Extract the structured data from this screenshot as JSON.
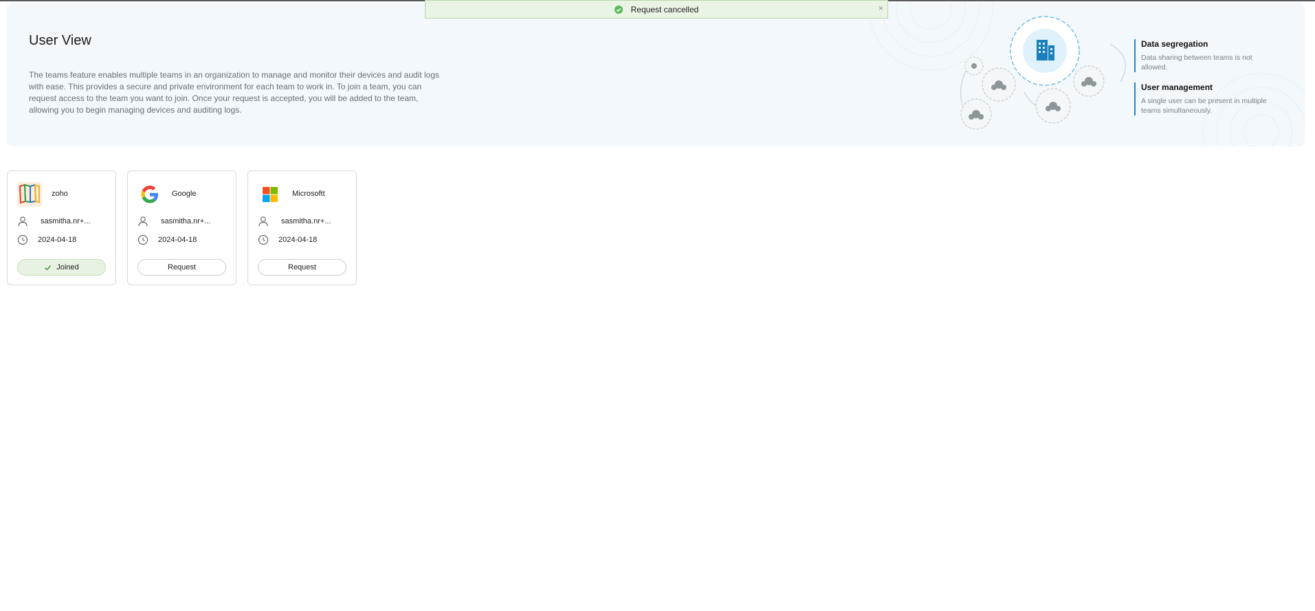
{
  "toast": {
    "message": "Request cancelled",
    "close": "×",
    "status_color": "#5cb85c"
  },
  "banner": {
    "title": "User View",
    "description": "The teams feature enables multiple teams in an organization to manage and monitor their devices and audit logs with ease. This provides a secure and private environment for each team to work in. To join a team, you can request access to the team you want to join. Once your request is accepted, you will be added to the team, allowing you to begin managing devices and auditing logs.",
    "features": [
      {
        "title": "Data segregation",
        "description": "Data sharing between teams is not allowed."
      },
      {
        "title": "User management",
        "description": "A single user can be present in multiple teams simultaneously."
      }
    ],
    "accent_color": "#1c8ad1"
  },
  "teams": [
    {
      "name": "zoho",
      "logo": "zoho-logo-icon",
      "owner": "sasmitha.nr+...",
      "date": "2024-04-18",
      "action": "Joined",
      "joined": true
    },
    {
      "name": "Google",
      "logo": "google-logo-icon",
      "owner": "sasmitha.nr+...",
      "date": "2024-04-18",
      "action": "Request",
      "joined": false
    },
    {
      "name": "Microsoftt",
      "logo": "microsoft-logo-icon",
      "owner": "sasmitha.nr+...",
      "date": "2024-04-18",
      "action": "Request",
      "joined": false
    }
  ]
}
